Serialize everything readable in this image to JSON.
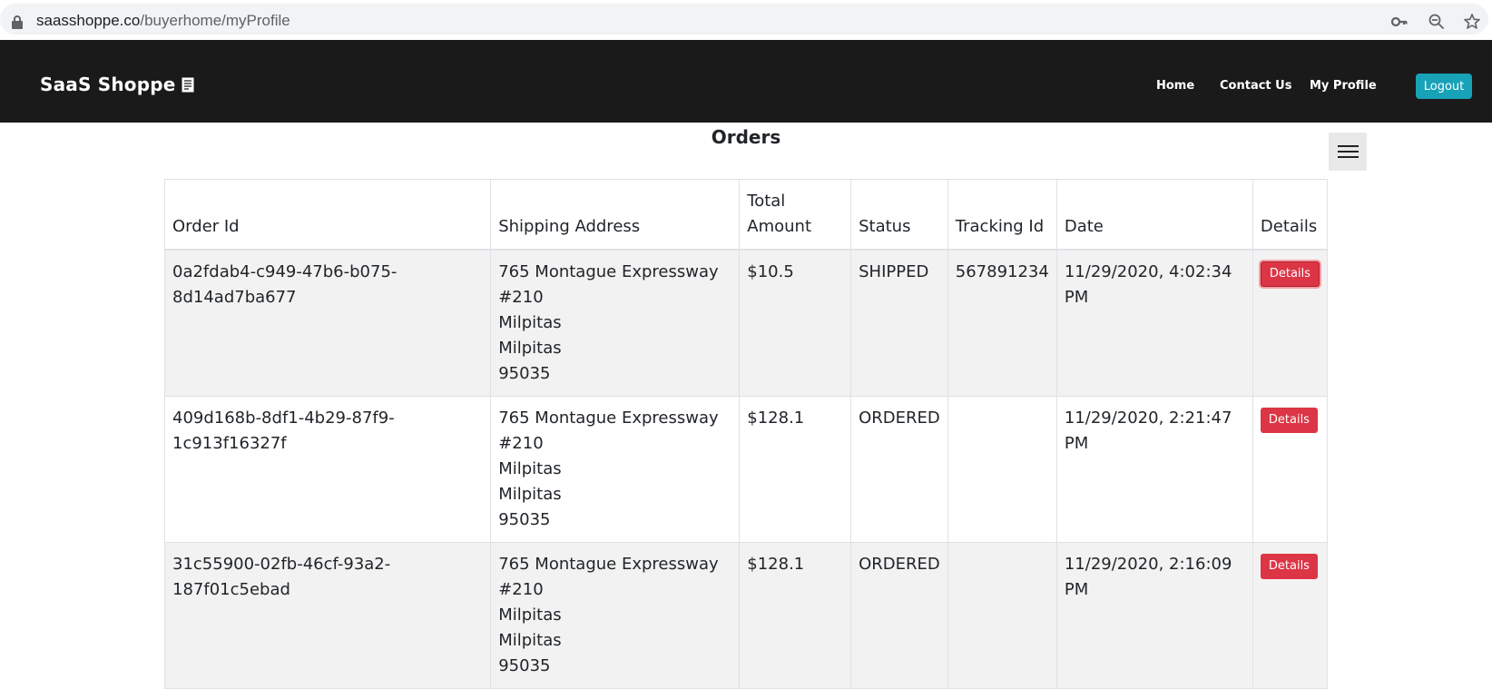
{
  "browser": {
    "url_domain": "saasshoppe.co",
    "url_path": "/buyerhome/myProfile"
  },
  "navbar": {
    "brand": "SaaS Shoppe",
    "links": [
      "Home",
      "Contact Us",
      "My Profile"
    ],
    "logout_label": "Logout"
  },
  "page": {
    "title": "Orders"
  },
  "table": {
    "headers": {
      "order_id": "Order Id",
      "shipping_address": "Shipping Address",
      "total_amount_line1": "Total",
      "total_amount_line2": "Amount",
      "status": "Status",
      "tracking_id": "Tracking Id",
      "date": "Date",
      "details": "Details"
    },
    "rows": [
      {
        "order_id_line1": "0a2fdab4-c949-47b6-b075-",
        "order_id_line2": "8d14ad7ba677",
        "address": [
          "765 Montague Expressway",
          "#210",
          "Milpitas",
          "Milpitas",
          "95035"
        ],
        "total": "$10.5",
        "status": "SHIPPED",
        "tracking_id": "567891234",
        "date_line1": "11/29/2020, 4:02:34",
        "date_line2": "PM",
        "details_label": "Details"
      },
      {
        "order_id_line1": "409d168b-8df1-4b29-87f9-1c913f16327f",
        "order_id_line2": "",
        "address": [
          "765 Montague Expressway",
          "#210",
          "Milpitas",
          "Milpitas",
          "95035"
        ],
        "total": "$128.1",
        "status": "ORDERED",
        "tracking_id": "",
        "date_line1": "11/29/2020, 2:21:47",
        "date_line2": "PM",
        "details_label": "Details"
      },
      {
        "order_id_line1": "31c55900-02fb-46cf-93a2-187f01c5ebad",
        "order_id_line2": "",
        "address": [
          "765 Montague Expressway",
          "#210",
          "Milpitas",
          "Milpitas",
          "95035"
        ],
        "total": "$128.1",
        "status": "ORDERED",
        "tracking_id": "",
        "date_line1": "11/29/2020, 2:16:09",
        "date_line2": "PM",
        "details_label": "Details"
      }
    ]
  },
  "colors": {
    "navbar_bg": "#1b1a1a",
    "logout_bg": "#17a2b8",
    "details_bg": "#dc3545",
    "striped_row": "#f2f2f2"
  }
}
